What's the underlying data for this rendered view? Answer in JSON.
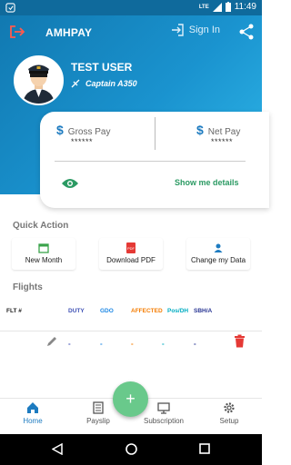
{
  "status": {
    "time": "11:49",
    "network": "LTE"
  },
  "header": {
    "title": "AMHPAY",
    "signin_label": "Sign In"
  },
  "profile": {
    "name": "TEST USER",
    "role": "Captain A350"
  },
  "pay": {
    "gross_label": "Gross Pay",
    "gross_value": "******",
    "net_label": "Net Pay",
    "net_value": "******",
    "details_label": "Show me details"
  },
  "quick_action": {
    "title": "Quick Action",
    "items": [
      {
        "label": "New Month",
        "icon": "calendar-icon"
      },
      {
        "label": "Download PDF",
        "icon": "pdf-icon"
      },
      {
        "label": "Change my Data",
        "icon": "person-icon"
      }
    ]
  },
  "flights": {
    "title": "Flights",
    "columns": [
      "FLT #",
      "DUTY",
      "GDO",
      "AFFECTED",
      "Pos/DH",
      "SBH/A"
    ],
    "row": [
      "-",
      "-",
      "-",
      "-",
      "-"
    ]
  },
  "nav": {
    "items": [
      {
        "label": "Home",
        "icon": "home-icon"
      },
      {
        "label": "Payslip",
        "icon": "payslip-icon"
      },
      {
        "label": "Subscription",
        "icon": "subscription-icon"
      },
      {
        "label": "Setup",
        "icon": "gear-icon"
      }
    ]
  },
  "fab": {
    "symbol": "+"
  },
  "colors": {
    "primary": "#1d7bc0",
    "accent_green": "#2b9a63",
    "fab": "#69c98b",
    "delete": "#e53935"
  }
}
